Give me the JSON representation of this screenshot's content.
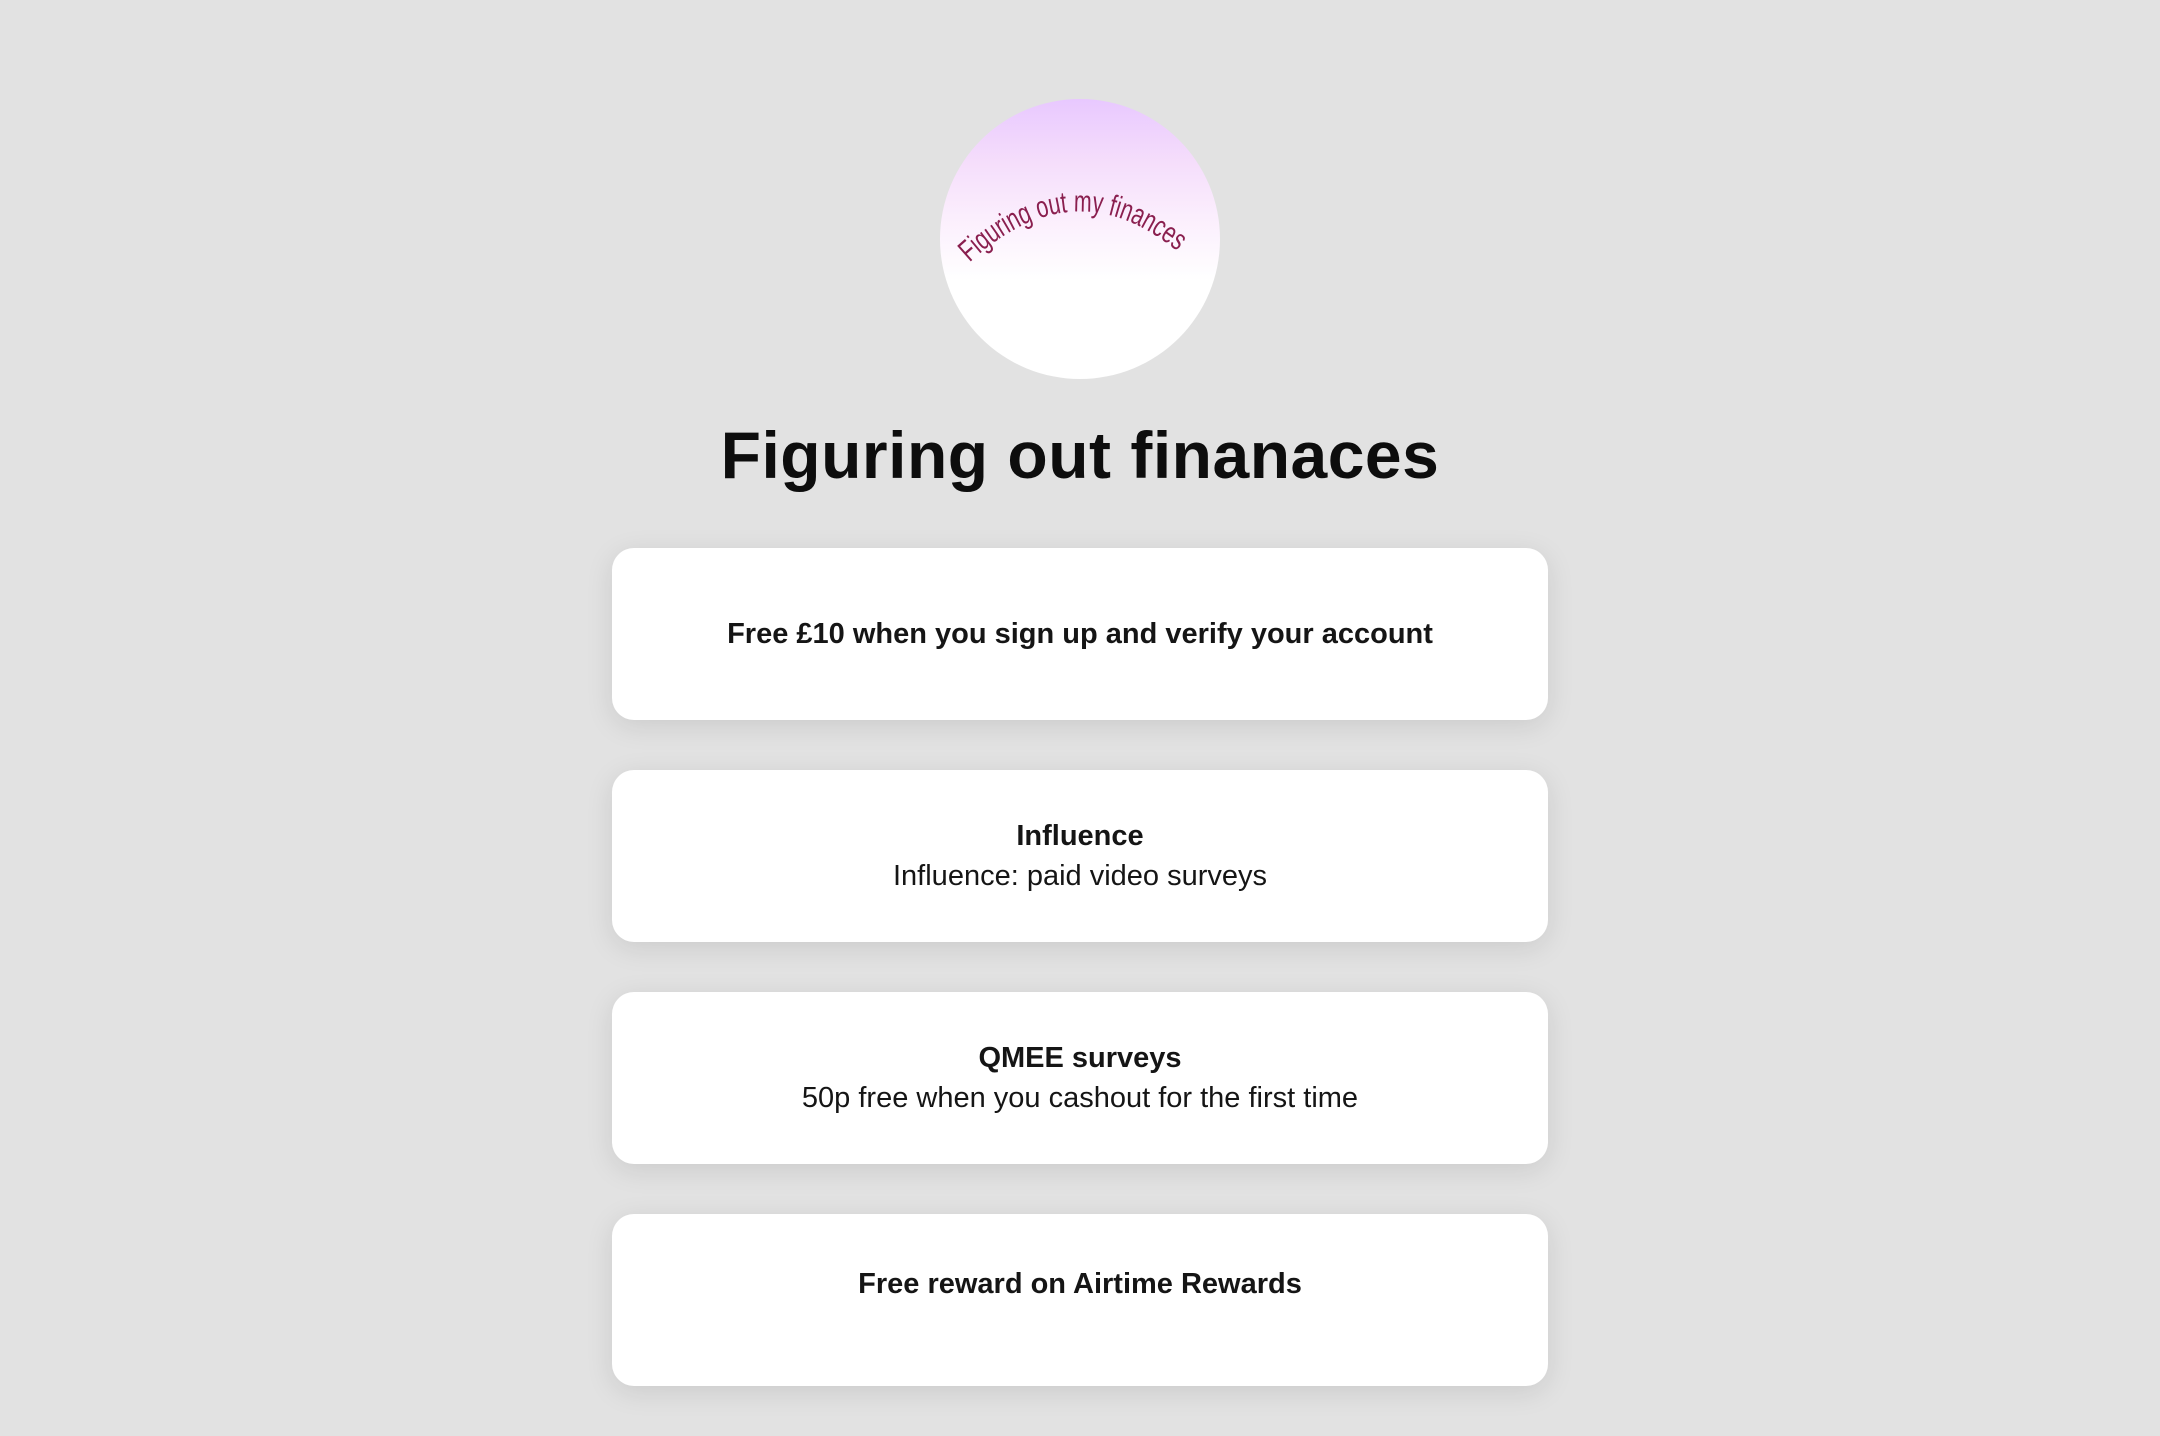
{
  "profile": {
    "avatar_text": "Figuring out  my finances",
    "title": "Figuring out finanaces",
    "colors": {
      "background": "#e2e2e2",
      "card": "#ffffff",
      "avatar_text": "#8a1f4f"
    }
  },
  "links": [
    {
      "title": "Free £10 when you sign up and verify your account",
      "description": ""
    },
    {
      "title": "Influence",
      "description": "Influence: paid video surveys"
    },
    {
      "title": "QMEE surveys",
      "description": "50p free when you cashout for the first time"
    },
    {
      "title": "Free reward on Airtime Rewards",
      "description": ""
    }
  ]
}
